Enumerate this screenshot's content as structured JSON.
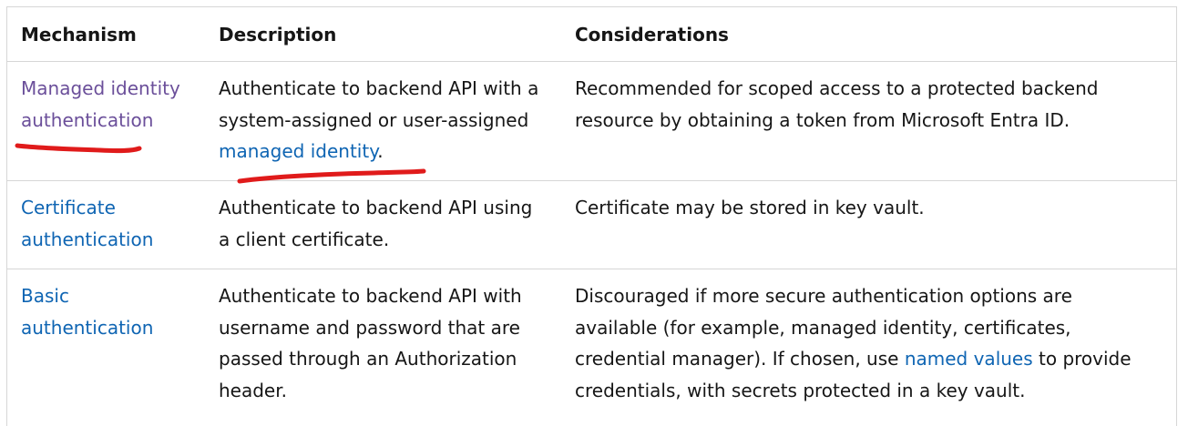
{
  "table": {
    "headers": [
      "Mechanism",
      "Description",
      "Considerations"
    ],
    "rows": [
      {
        "mechanism_lines": [
          "Managed identity",
          "authentication"
        ],
        "description_lines": [
          "Authenticate to backend API with a",
          "system-assigned or user-assigned"
        ],
        "description_link": "managed identity",
        "description_after_link": ".",
        "considerations_lines": [
          "Recommended for scoped access to a protected backend",
          "resource by obtaining a token from Microsoft Entra ID."
        ]
      },
      {
        "mechanism_lines": [
          "Certificate",
          "authentication"
        ],
        "description_lines": [
          "Authenticate to backend API using",
          "a client certificate."
        ],
        "considerations_lines": [
          "Certificate may be stored in key vault."
        ]
      },
      {
        "mechanism_lines": [
          "Basic",
          "authentication"
        ],
        "description_lines": [
          "Authenticate to backend API with",
          "username and password that are",
          "passed through an Authorization",
          "header."
        ],
        "considerations_lines": [
          "Discouraged if more secure authentication options are",
          "available (for example, managed identity, certificates,",
          "credential manager). If chosen, use "
        ],
        "considerations_link": "named values",
        "considerations_after_link": " to provide",
        "considerations_last_line": "credentials, with secrets protected in a key vault."
      }
    ]
  },
  "colors": {
    "link": "#0f65b3",
    "visited_link": "#6b4f9a",
    "annotation": "#e01b1b",
    "border": "#d6d6d6"
  }
}
